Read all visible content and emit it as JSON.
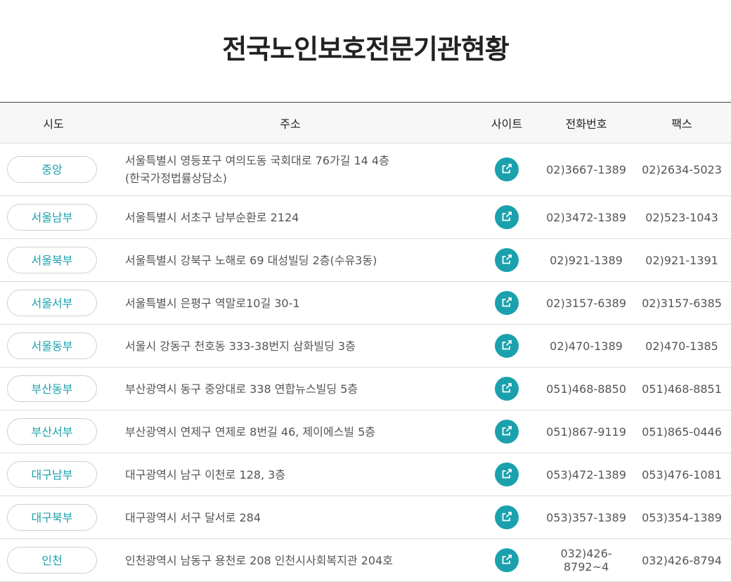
{
  "page": {
    "title": "전국노인보호전문기관현황"
  },
  "table": {
    "headers": {
      "region": "시도",
      "address": "주소",
      "site": "사이트",
      "phone": "전화번호",
      "fax": "팩스"
    },
    "rows": [
      {
        "region": "중앙",
        "address": [
          "서울특별시 영등포구 여의도동 국회대로 76가길 14 4층",
          "(한국가정법률상담소)"
        ],
        "phone": "02)3667-1389",
        "fax": "02)2634-5023"
      },
      {
        "region": "서울남부",
        "address": [
          "서울특별시 서초구 남부순환로 2124"
        ],
        "phone": "02)3472-1389",
        "fax": "02)523-1043"
      },
      {
        "region": "서울북부",
        "address": [
          "서울특별시 강북구 노해로 69 대성빌딩 2층(수유3동)"
        ],
        "phone": "02)921-1389",
        "fax": "02)921-1391"
      },
      {
        "region": "서울서부",
        "address": [
          "서울특별시 은평구 역말로10길 30-1"
        ],
        "phone": "02)3157-6389",
        "fax": "02)3157-6385"
      },
      {
        "region": "서울동부",
        "address": [
          "서울시 강동구 천호동 333-38번지 삼화빌딩 3층"
        ],
        "phone": "02)470-1389",
        "fax": "02)470-1385"
      },
      {
        "region": "부산동부",
        "address": [
          "부산광역시 동구 중앙대로 338 연합뉴스빌딩 5층"
        ],
        "phone": "051)468-8850",
        "fax": "051)468-8851"
      },
      {
        "region": "부산서부",
        "address": [
          "부산광역시 연제구 연제로 8번길 46, 제이에스빌 5층"
        ],
        "phone": "051)867-9119",
        "fax": "051)865-0446"
      },
      {
        "region": "대구남부",
        "address": [
          "대구광역시 남구 이천로 128, 3층"
        ],
        "phone": "053)472-1389",
        "fax": "053)476-1081"
      },
      {
        "region": "대구북부",
        "address": [
          "대구광역시 서구 달서로 284"
        ],
        "phone": "053)357-1389",
        "fax": "053)354-1389"
      },
      {
        "region": "인천",
        "address": [
          "인천광역시 남동구 용천로 208 인천시사회복지관 204호"
        ],
        "phone": "032)426-8792~4",
        "fax": "032)426-8794"
      }
    ]
  },
  "icons": {
    "site_button": "external-link-icon"
  },
  "colors": {
    "accent": "#1aa1ad",
    "header_bg": "#f7f7f7",
    "title": "#222222"
  }
}
